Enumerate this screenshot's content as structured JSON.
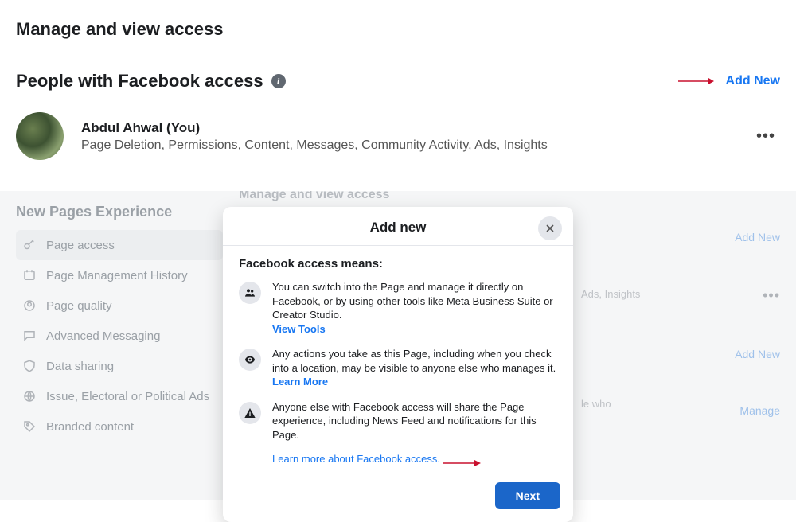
{
  "page": {
    "title": "Manage and view access",
    "section_title": "People with Facebook access",
    "add_new_label": "Add New"
  },
  "user": {
    "name": "Abdul Ahwal (You)",
    "perms": "Page Deletion, Permissions, Content, Messages, Community Activity, Ads, Insights"
  },
  "bg": {
    "ghost_title": "Manage and view access",
    "nav_title": "New Pages Experience",
    "items": [
      {
        "label": "Page access"
      },
      {
        "label": "Page Management History"
      },
      {
        "label": "Page quality"
      },
      {
        "label": "Advanced Messaging"
      },
      {
        "label": "Data sharing"
      },
      {
        "label": "Issue, Electoral or Political Ads"
      },
      {
        "label": "Branded content"
      }
    ],
    "right": {
      "add_new": "Add New",
      "add_new2": "Add New",
      "manage": "Manage"
    },
    "faded1": "Ads, Insights",
    "faded2": "le who"
  },
  "modal": {
    "title": "Add new",
    "means_title": "Facebook access means:",
    "row1_text": "You can switch into the Page and manage it directly on Facebook, or by using other tools like Meta Business Suite or Creator Studio. ",
    "row1_link": "View Tools",
    "row2_text": "Any actions you take as this Page, including when you check into a location, may be visible to anyone else who manages it. ",
    "row2_link": "Learn More",
    "row3_text": "Anyone else with Facebook access will share the Page experience, including News Feed and notifications for this Page.",
    "learn_access": "Learn more about Facebook access.",
    "next": "Next"
  }
}
